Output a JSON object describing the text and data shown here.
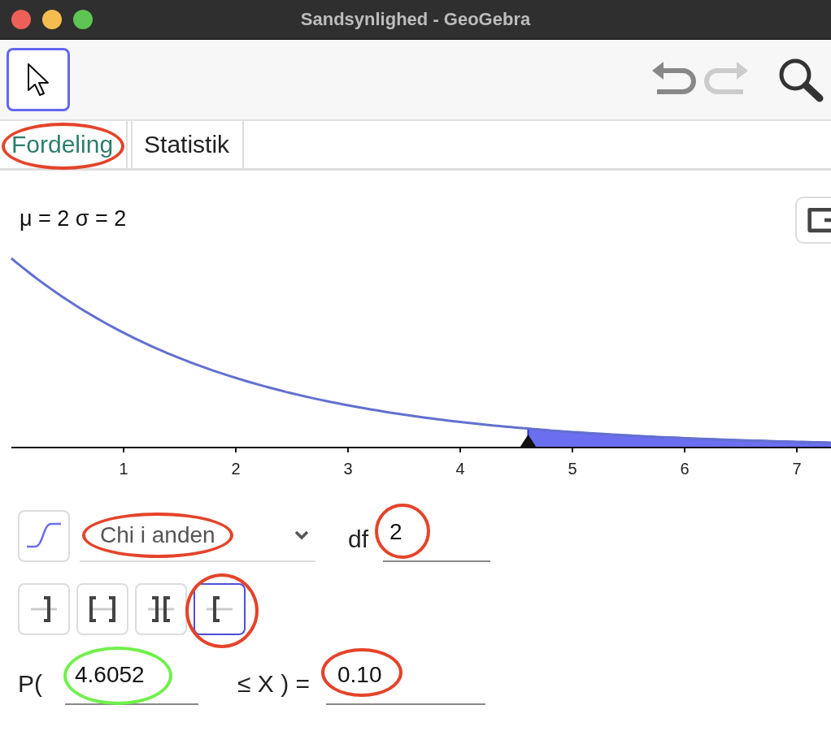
{
  "window": {
    "title": "Sandsynlighed - GeoGebra"
  },
  "toolbar": {
    "move_tool": {
      "selected": true
    },
    "undo": {
      "disabled": false
    },
    "redo": {
      "disabled": true
    }
  },
  "tabs": [
    {
      "label": "Fordeling",
      "selected": true,
      "circle": {
        "color": "#e5432a"
      }
    },
    {
      "label": "Statistik",
      "selected": false
    }
  ],
  "graph": {
    "parameters": "μ = 2 σ = 2",
    "x_ticks": [
      "1",
      "2",
      "3",
      "4",
      "5",
      "6",
      "7"
    ]
  },
  "distribution": {
    "value": "Chi i anden",
    "circle": {
      "color": "#e5432a"
    }
  },
  "df": {
    "label": "df",
    "value": "2",
    "circle": {
      "color": "#e5432a"
    }
  },
  "interval_buttons": [
    {
      "kind": "left",
      "selected": false
    },
    {
      "kind": "interval",
      "selected": false
    },
    {
      "kind": "two-tailed",
      "selected": false
    },
    {
      "kind": "right",
      "selected": true,
      "circle": {
        "color": "#e5432a"
      }
    }
  ],
  "probability": {
    "prefix": "P(",
    "low": {
      "value": "4.6052",
      "circle": {
        "color": "#6ff04a"
      }
    },
    "middle": "≤ X ) =",
    "result": {
      "value": "0.10",
      "circle": {
        "color": "#e5432a"
      }
    }
  }
}
